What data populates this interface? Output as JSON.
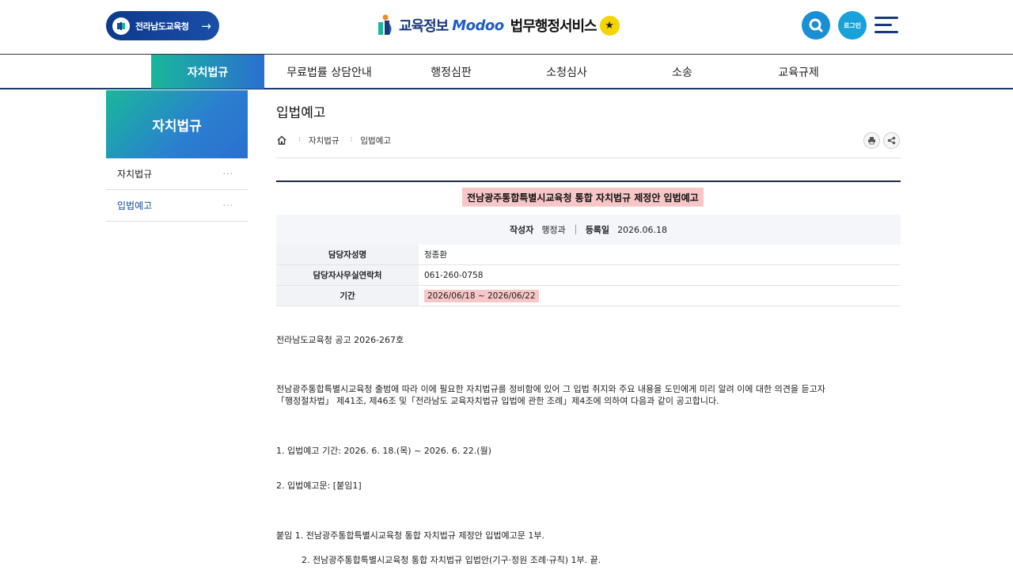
{
  "header": {
    "back_label": "전라남도교육청",
    "brand_part1": "교육정보",
    "brand_part2": "Modoo",
    "brand_part3": "법무행정서비스",
    "brand_star": "★",
    "login_label": "로그인"
  },
  "gnb": {
    "items": [
      "자치법규",
      "무료법률 상담안내",
      "행정심판",
      "소청심사",
      "소송",
      "교육규제"
    ]
  },
  "sidebar": {
    "title": "자치법규",
    "items": [
      {
        "label": "자치법규",
        "dots": "···"
      },
      {
        "label": "입법예고",
        "dots": "···"
      }
    ]
  },
  "content": {
    "page_title": "입법예고",
    "breadcrumb": [
      "자치법규",
      "입법예고"
    ],
    "breadcrumb_sep": "⁝",
    "post_title": "전남광주통합특별시교육청 통합 자치법규 제정안 입법예고",
    "meta": {
      "author_label": "작성자",
      "author": "행정과",
      "date_label": "등록일",
      "date": "2026.06.18"
    },
    "info": [
      {
        "label": "담당자성명",
        "value": "정종환"
      },
      {
        "label": "담당자사무실연락처",
        "value": "061-260-0758"
      },
      {
        "label": "기간",
        "value": "2026/06/18 ~ 2026/06/22"
      }
    ],
    "body": {
      "notice_no": "전라남도교육청 공고 2026-267호",
      "para1_line1": "전남광주통합특별시교육청 출범에 따라 이에 필요한 자치법규를 정비함에 있어 그 입법 취지와 주요 내용을 도민에게 미리 알려 이에 대한 의견을 듣고자",
      "para1_line2": "「행정절차법」 제41조, 제46조 및「전라남도 교육자치법규 입법에 관한 조례」제4조에 의하여 다음과 같이 공고합니다.",
      "item1": "1. 입법예고 기간: 2026. 6. 18.(목) ~ 2026. 6. 22.(월)",
      "item2": "2. 입법예고문: [붙임1]",
      "attach1": "붙임  1. 전남광주통합특별시교육청 통합 자치법규 제정안 입법예고문 1부.",
      "attach2": "2. 전남광주통합특별시교육청 통합 자치법규 입법안(기구·정원 조례·규칙) 1부.  끝."
    }
  },
  "colors": {
    "navy": "#173a7a",
    "accent_blue": "#1a8fd4",
    "teal": "#18b89a",
    "highlight": "#f7c6c6",
    "star": "#f5d400"
  }
}
